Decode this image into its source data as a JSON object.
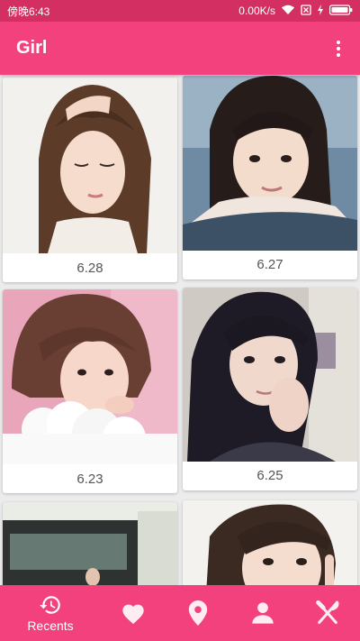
{
  "status_bar": {
    "time": "傍晚6:43",
    "network_speed": "0.00K/s",
    "icons": [
      "wifi-icon",
      "no-sim-icon",
      "charging-icon",
      "battery-icon"
    ]
  },
  "app_bar": {
    "title": "Girl",
    "menu_icon": "more-vert-icon"
  },
  "gallery": {
    "cards": [
      {
        "date": "6.28",
        "photo": "portrait-photo"
      },
      {
        "date": "6.27",
        "photo": "portrait-photo"
      },
      {
        "date": "6.23",
        "photo": "portrait-photo"
      },
      {
        "date": "6.25",
        "photo": "portrait-photo"
      },
      {
        "date": "",
        "photo": "portrait-photo"
      },
      {
        "date": "",
        "photo": "portrait-photo"
      }
    ]
  },
  "bottom_nav": {
    "items": [
      {
        "label": "Recents",
        "icon": "history-icon",
        "active": true
      },
      {
        "label": "",
        "icon": "heart-icon",
        "active": false
      },
      {
        "label": "",
        "icon": "location-pin-icon",
        "active": false
      },
      {
        "label": "",
        "icon": "person-icon",
        "active": false
      },
      {
        "label": "",
        "icon": "fork-knife-icon",
        "active": false
      }
    ]
  },
  "colors": {
    "status_bar": "#d42f63",
    "primary": "#f2417d",
    "background": "#ececec",
    "card": "#ffffff",
    "date_text": "#555555"
  }
}
